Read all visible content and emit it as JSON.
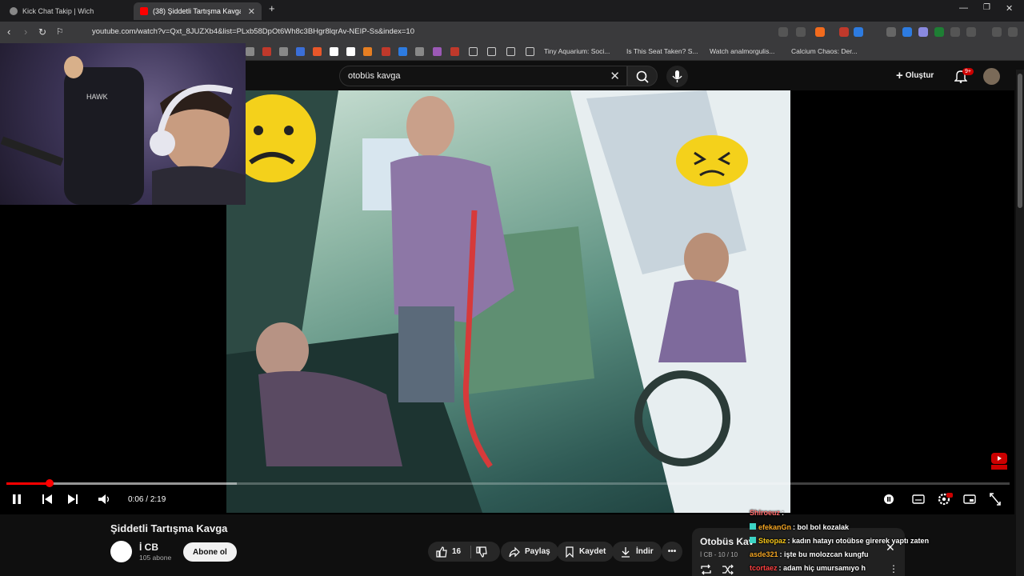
{
  "browser": {
    "tabs": [
      {
        "title": "Kick Chat Takip | Wich",
        "active": false
      },
      {
        "title": "(38) Şiddetli Tartışma Kavga -",
        "active": true
      }
    ],
    "url": "youtube.com/watch?v=Qxt_8JUZXb4&list=PLxb58DpOt6Wh8c3BHgr8lqrAv-NEIP-Ss&index=10",
    "bookmarks": [
      "Tiny Aquarium: Soci...",
      "Is This Seat Taken? S...",
      "Watch analmorgulis...",
      "Calcium Chaos: Der..."
    ]
  },
  "youtube": {
    "search_query": "otobüs kavga",
    "create_label": "Oluştur",
    "notification_count": "9+"
  },
  "player": {
    "time_current": "0:06",
    "time_total": "2:19",
    "progress_fraction": 0.043,
    "buffered_fraction": 0.23
  },
  "video": {
    "title": "Şiddetli Tartışma Kavga",
    "channel_name": "İ CB",
    "subscribers": "105 abone",
    "subscribe_label": "Abone ol",
    "likes": "16",
    "share_label": "Paylaş",
    "save_label": "Kaydet",
    "download_label": "İndir"
  },
  "playlist": {
    "title": "Otobüs Kav",
    "subtitle": "İ CB - 10 / 10"
  },
  "chat": [
    {
      "user": "Shiroeuz",
      "text": ":",
      "color": "#ff6b6b"
    },
    {
      "user": "efekanGn",
      "text": ": bol bol kozalak",
      "color": "#f5a623"
    },
    {
      "user": "Steopaz",
      "text": ": kadın hatayı otoübse girerek yaptı zaten",
      "color": "#f5c518"
    },
    {
      "user": "asde321",
      "text": ": işte bu molozcan kungfu",
      "color": "#f5a623"
    },
    {
      "user": "tcortaez",
      "text": ": adam hiç umursamıyo h",
      "color": "#ff4040"
    }
  ],
  "colors": {
    "accent_red": "#ff0000",
    "background": "#0f0f0f",
    "chrome_bar": "#3a3a3c"
  }
}
